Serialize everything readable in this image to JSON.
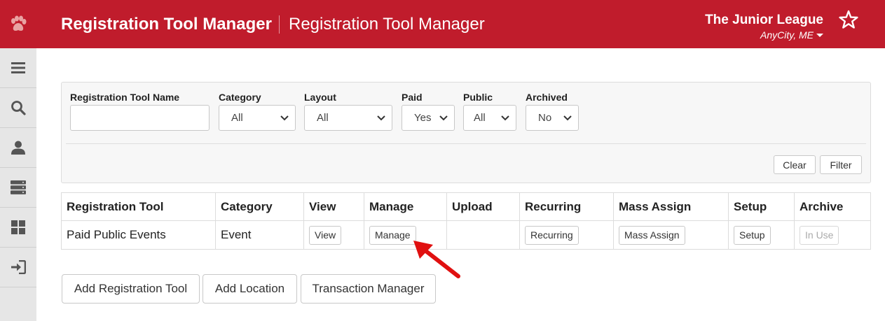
{
  "header": {
    "title": "Registration Tool Manager",
    "subtitle": "Registration Tool Manager",
    "org_name": "The Junior League",
    "org_location": "AnyCity, ME",
    "brand_color": "#c01c2c",
    "logo_icon": "paw-icon",
    "favorite_icon": "star-outline-icon"
  },
  "sidebar": {
    "items": [
      {
        "icon": "menu-icon"
      },
      {
        "icon": "search-icon"
      },
      {
        "icon": "user-icon"
      },
      {
        "icon": "server-icon"
      },
      {
        "icon": "grid-icon"
      },
      {
        "icon": "sign-in-icon"
      }
    ]
  },
  "filters": {
    "name_label": "Registration Tool Name",
    "name_value": "",
    "category_label": "Category",
    "category_value": "All",
    "layout_label": "Layout",
    "layout_value": "All",
    "paid_label": "Paid",
    "paid_value": "Yes",
    "public_label": "Public",
    "public_value": "All",
    "archived_label": "Archived",
    "archived_value": "No",
    "clear_label": "Clear",
    "filter_label": "Filter"
  },
  "table": {
    "headers": [
      "Registration Tool",
      "Category",
      "View",
      "Manage",
      "Upload",
      "Recurring",
      "Mass Assign",
      "Setup",
      "Archive"
    ],
    "row": {
      "name": "Paid Public Events",
      "category": "Event",
      "view_label": "View",
      "manage_label": "Manage",
      "recurring_label": "Recurring",
      "mass_assign_label": "Mass Assign",
      "setup_label": "Setup",
      "archive_label": "In Use"
    }
  },
  "actions": {
    "add_tool_label": "Add Registration Tool",
    "add_location_label": "Add Location",
    "transaction_label": "Transaction Manager"
  },
  "annotation": {
    "arrow_color": "#e01010"
  }
}
